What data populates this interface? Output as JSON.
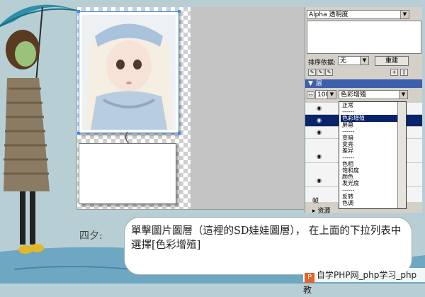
{
  "panel": {
    "top_dropdown": "Alpha 透明度",
    "sort_label": "排序依据:",
    "sort_value": "无",
    "rebuild_button": "重建",
    "layers_title": "层",
    "opacity": "100",
    "blend_value": "色彩增殖",
    "frame_label": "帧",
    "history_label": "▸ 资源"
  },
  "blend_menu": {
    "items": [
      "正常",
      "------",
      "色彩增殖",
      "屏幕",
      "------",
      "变暗",
      "变亮",
      "差异",
      "------",
      "色相",
      "饱和度",
      "颜色",
      "发光度",
      "------",
      "反转",
      "色调",
      "------"
    ],
    "selected_index": 2
  },
  "caption": {
    "speaker": "四夕:",
    "text": "單擊圖片圖層（這裡的SD娃娃圖層）， 在上面的下拉列表中選擇[色彩增殖]"
  },
  "watermark": {
    "logo": "P",
    "text": "自学PHP网_php学习_php教"
  },
  "colors": {
    "selection_blue": "#3a8ee6",
    "layers_bar": "#3c5fae",
    "menu_highlight": "#0a246a",
    "sky_blue": "#b7cfd4",
    "logo_orange": "#e8622a"
  }
}
